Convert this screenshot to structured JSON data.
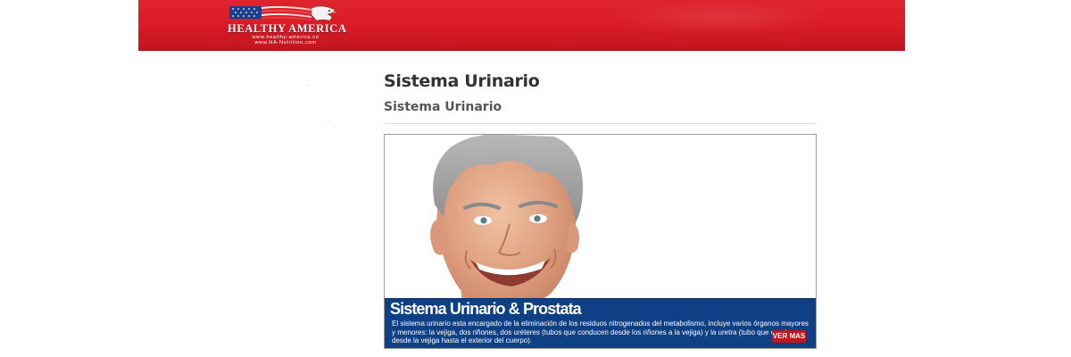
{
  "header": {
    "logo": {
      "title": "HEALTHY AMERICA",
      "url_primary": "www.healthy-america.co",
      "url_secondary": "www.HA-Nutrition.com"
    },
    "brand_color": "#d81b26"
  },
  "main": {
    "title": "Sistema Urinario",
    "subtitle": "Sistema Urinario"
  },
  "banner": {
    "image_subject": "smiling gray-haired man portrait",
    "heading": "Sistema Urinario & Prostata",
    "description": "El sistema urinario esta encargado de la eliminación de los residuos nitrogenados del metabolismo, incluye varios órganos mayores y menores: la vejiga, dos riñones, dos uréteres (tubos que conducen desde los riñones a la vejiga) y la uretra (tubo que conduce desde la vejiga hasta el exterior del cuerpo).",
    "cta_label": "VER MAS",
    "bar_color": "#0f3f85",
    "cta_color": "#c0161e"
  }
}
